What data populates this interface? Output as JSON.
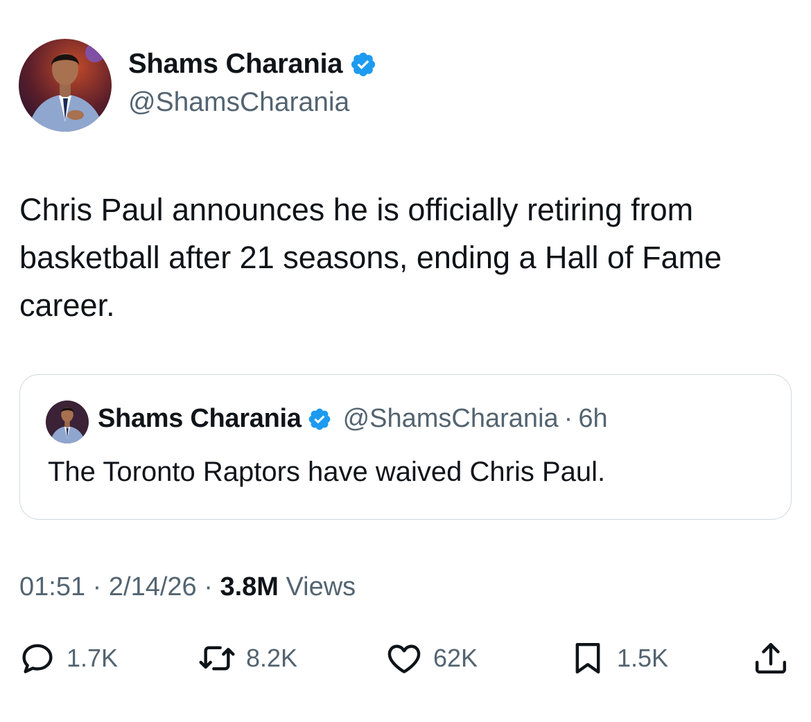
{
  "tweet": {
    "author": {
      "display_name": "Shams Charania",
      "handle": "@ShamsCharania",
      "verified": true
    },
    "text": "Chris Paul announces he is officially retiring from basketball after 21 seasons, ending a Hall of Fame career.",
    "quote": {
      "display_name": "Shams Charania",
      "handle": "@ShamsCharania",
      "separator": "·",
      "time": "6h",
      "text": "The Toronto Raptors have waived Chris Paul."
    },
    "meta": {
      "time": "01:51",
      "date": "2/14/26",
      "separator": "·",
      "views_count": "3.8M",
      "views_label": "Views"
    },
    "actions": {
      "replies": "1.7K",
      "reposts": "8.2K",
      "likes": "62K",
      "bookmarks": "1.5K"
    }
  },
  "colors": {
    "text": "#0f1419",
    "secondary": "#536471",
    "verified": "#1d9bf0",
    "border": "#cfd9de"
  },
  "icons": [
    "verified-badge-icon",
    "reply-icon",
    "repost-icon",
    "like-icon",
    "bookmark-icon",
    "share-icon"
  ]
}
